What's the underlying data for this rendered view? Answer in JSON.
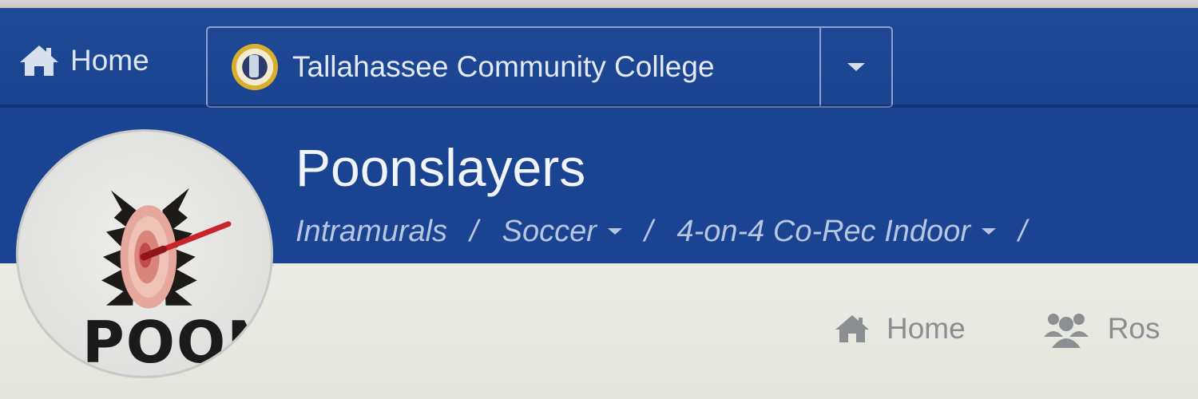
{
  "topnav": {
    "home_label": "Home",
    "school": {
      "name": "Tallahassee Community College"
    }
  },
  "team": {
    "name": "Poonslayers",
    "avatar_text": "POON"
  },
  "breadcrumb": [
    {
      "label": "Intramurals"
    },
    {
      "label": "Soccer"
    },
    {
      "label": "4-on-4 Co-Rec Indoor"
    }
  ],
  "tabs": [
    {
      "label": "Home",
      "icon": "home-icon"
    },
    {
      "label": "Ros",
      "icon": "roster-icon"
    }
  ],
  "colors": {
    "nav_blue": "#1f4a96",
    "header_blue": "#1a4391",
    "content_bg": "#e4e6de"
  }
}
